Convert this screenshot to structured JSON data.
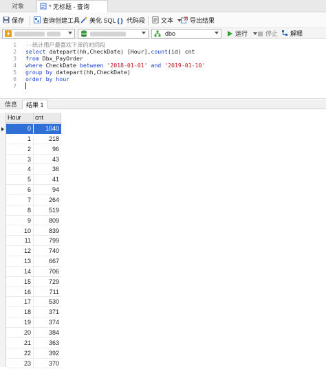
{
  "tabs": {
    "objects": "对象",
    "query": "* 无标题 - 查询"
  },
  "toolbar": {
    "save": "保存",
    "query_builder": "查询创建工具",
    "beautify": "美化 SQL",
    "snippet": "代码段",
    "text": "文本",
    "export": "导出结果"
  },
  "connbar": {
    "schema": "dbo",
    "run": "运行",
    "stop": "停止",
    "explain": "解释"
  },
  "editor": {
    "lines": [
      {
        "n": "1",
        "parts": [
          {
            "t": "--统计用户最喜欢下单的时间段",
            "c": "cm"
          }
        ]
      },
      {
        "n": "2",
        "parts": [
          {
            "t": "select",
            "c": "kw"
          },
          {
            "t": " datepart(hh,CheckDate) [Hour],",
            "c": ""
          },
          {
            "t": "count",
            "c": "kw"
          },
          {
            "t": "(id) cnt",
            "c": ""
          }
        ]
      },
      {
        "n": "3",
        "parts": [
          {
            "t": "from",
            "c": "kw"
          },
          {
            "t": " Dbx_PayOrder",
            "c": ""
          }
        ]
      },
      {
        "n": "4",
        "parts": [
          {
            "t": "where",
            "c": "kw"
          },
          {
            "t": " CheckDate ",
            "c": ""
          },
          {
            "t": "between",
            "c": "kw"
          },
          {
            "t": " ",
            "c": ""
          },
          {
            "t": "'2018-01-01'",
            "c": "str"
          },
          {
            "t": " ",
            "c": ""
          },
          {
            "t": "and",
            "c": "kw"
          },
          {
            "t": " ",
            "c": ""
          },
          {
            "t": "'2019-01-10'",
            "c": "str"
          }
        ]
      },
      {
        "n": "5",
        "parts": [
          {
            "t": "group by",
            "c": "kw"
          },
          {
            "t": " datepart(hh,CheckDate)",
            "c": ""
          }
        ]
      },
      {
        "n": "6",
        "parts": [
          {
            "t": "order by",
            "c": "kw"
          },
          {
            "t": " hour",
            "c": "kw"
          }
        ]
      },
      {
        "n": "7",
        "parts": []
      }
    ]
  },
  "results": {
    "tab_info": "信息",
    "tab_result": "结果 1",
    "columns": [
      "Hour",
      "cnt"
    ],
    "rows": [
      [
        "0",
        "1040"
      ],
      [
        "1",
        "218"
      ],
      [
        "2",
        "96"
      ],
      [
        "3",
        "43"
      ],
      [
        "4",
        "36"
      ],
      [
        "5",
        "41"
      ],
      [
        "6",
        "94"
      ],
      [
        "7",
        "264"
      ],
      [
        "8",
        "519"
      ],
      [
        "9",
        "809"
      ],
      [
        "10",
        "839"
      ],
      [
        "11",
        "799"
      ],
      [
        "12",
        "740"
      ],
      [
        "13",
        "667"
      ],
      [
        "14",
        "706"
      ],
      [
        "15",
        "729"
      ],
      [
        "16",
        "711"
      ],
      [
        "17",
        "530"
      ],
      [
        "18",
        "371"
      ],
      [
        "19",
        "374"
      ],
      [
        "20",
        "384"
      ],
      [
        "21",
        "363"
      ],
      [
        "22",
        "392"
      ],
      [
        "23",
        "370"
      ]
    ],
    "selected_row": 0
  },
  "colors": {
    "selection": "#2f6fd6",
    "keyword": "#1a3fd0",
    "string": "#c0141b",
    "comment": "#8a8a8a"
  }
}
